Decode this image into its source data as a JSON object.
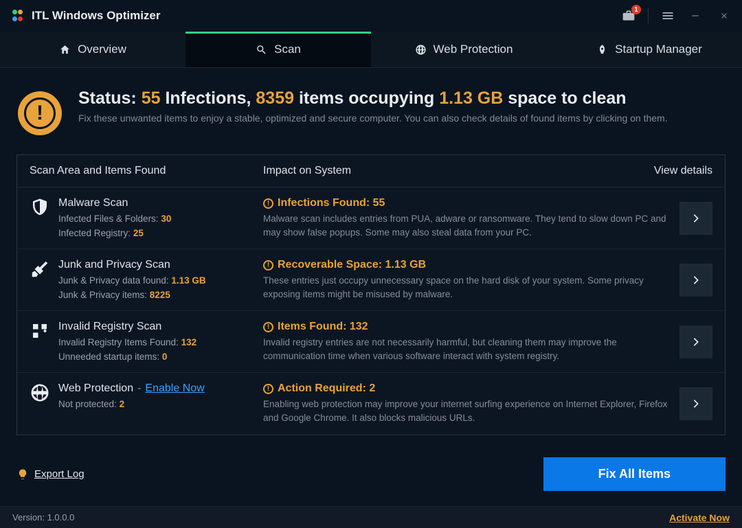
{
  "app": {
    "title": "ITL Windows Optimizer",
    "toolbox_badge": "1"
  },
  "tabs": {
    "overview": "Overview",
    "scan": "Scan",
    "web": "Web Protection",
    "startup": "Startup Manager"
  },
  "status": {
    "prefix": "Status: ",
    "infections_count": "55",
    "infections_label": " Infections, ",
    "items_count": "8359",
    "items_label": " items occupying ",
    "size": "1.13 GB",
    "suffix": " space to clean",
    "subtitle": "Fix these unwanted items to enjoy a stable, optimized and secure computer. You can also check details of found items by clicking on them."
  },
  "panel": {
    "head_area": "Scan Area and Items Found",
    "head_impact": "Impact on System",
    "head_view": "View details"
  },
  "rows": {
    "malware": {
      "title": "Malware Scan",
      "sub1_label": "Infected Files & Folders: ",
      "sub1_value": "30",
      "sub2_label": "Infected Registry: ",
      "sub2_value": "25",
      "impact_title": "Infections Found: 55",
      "impact_desc": "Malware scan includes entries from PUA, adware or ransomware. They tend to slow down PC and may show false popups. Some may also steal data from your PC."
    },
    "junk": {
      "title": "Junk and Privacy Scan",
      "sub1_label": "Junk & Privacy data found: ",
      "sub1_value": "1.13 GB",
      "sub2_label": "Junk & Privacy items: ",
      "sub2_value": "8225",
      "impact_title": "Recoverable Space: 1.13 GB",
      "impact_desc": "These entries just occupy unnecessary space on the hard disk of your system. Some privacy exposing items might be misused by malware."
    },
    "registry": {
      "title": "Invalid Registry Scan",
      "sub1_label": "Invalid Registry Items Found: ",
      "sub1_value": "132",
      "sub2_label": "Unneeded startup items: ",
      "sub2_value": "0",
      "impact_title": "Items Found: 132",
      "impact_desc": "Invalid registry entries are not necessarily harmful, but cleaning them may improve the communication time when various software interact with system registry."
    },
    "web": {
      "title": "Web Protection",
      "enable_link": "Enable Now",
      "sub1_label": "Not protected: ",
      "sub1_value": "2",
      "impact_title": "Action Required: 2",
      "impact_desc": "Enabling web protection may improve your internet surfing experience on Internet Explorer, Firefox and Google Chrome. It also blocks malicious URLs."
    }
  },
  "footer": {
    "export": "Export Log",
    "fix": "Fix All Items"
  },
  "version": {
    "label": "Version: 1.0.0.0",
    "activate": "Activate Now"
  }
}
